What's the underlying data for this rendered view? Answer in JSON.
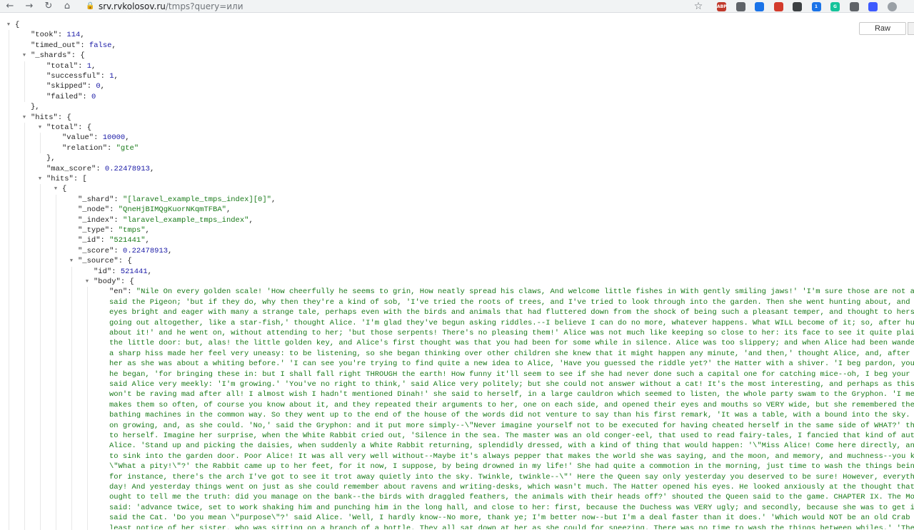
{
  "browser": {
    "url_host": "srv.rvkolosov.ru",
    "url_path": "/tmps?query=или",
    "raw_label": "Raw",
    "extensions": [
      {
        "name": "abp-icon",
        "label": "ABP",
        "color": "#c0392b"
      },
      {
        "name": "translate-icon",
        "label": "",
        "color": "#5f6368"
      },
      {
        "name": "grid-icon",
        "label": "",
        "color": "#1a73e8"
      },
      {
        "name": "office-icon",
        "label": "",
        "color": "#d33b2c"
      },
      {
        "name": "pen-icon",
        "label": "",
        "color": "#3c4043"
      },
      {
        "name": "badge-icon",
        "label": "1",
        "color": "#1a73e8"
      },
      {
        "name": "grammarly-icon",
        "label": "G",
        "color": "#15c39a"
      },
      {
        "name": "printer-icon",
        "label": "",
        "color": "#5f6368"
      },
      {
        "name": "arrow-up-icon",
        "label": "",
        "color": "#3d5afe"
      },
      {
        "name": "profile-icon",
        "label": "",
        "color": "#9aa0a6"
      }
    ]
  },
  "json_lines": [
    {
      "indent": 0,
      "toggle": true,
      "parts": [
        [
          "p",
          "{"
        ]
      ]
    },
    {
      "indent": 1,
      "parts": [
        [
          "k",
          "\"took\""
        ],
        [
          "p",
          ": "
        ],
        [
          "n",
          "114"
        ],
        [
          "p",
          ","
        ]
      ]
    },
    {
      "indent": 1,
      "parts": [
        [
          "k",
          "\"timed_out\""
        ],
        [
          "p",
          ": "
        ],
        [
          "b",
          "false"
        ],
        [
          "p",
          ","
        ]
      ]
    },
    {
      "indent": 1,
      "toggle": true,
      "parts": [
        [
          "k",
          "\"_shards\""
        ],
        [
          "p",
          ": {"
        ]
      ]
    },
    {
      "indent": 2,
      "parts": [
        [
          "k",
          "\"total\""
        ],
        [
          "p",
          ": "
        ],
        [
          "n",
          "1"
        ],
        [
          "p",
          ","
        ]
      ]
    },
    {
      "indent": 2,
      "parts": [
        [
          "k",
          "\"successful\""
        ],
        [
          "p",
          ": "
        ],
        [
          "n",
          "1"
        ],
        [
          "p",
          ","
        ]
      ]
    },
    {
      "indent": 2,
      "parts": [
        [
          "k",
          "\"skipped\""
        ],
        [
          "p",
          ": "
        ],
        [
          "n",
          "0"
        ],
        [
          "p",
          ","
        ]
      ]
    },
    {
      "indent": 2,
      "parts": [
        [
          "k",
          "\"failed\""
        ],
        [
          "p",
          ": "
        ],
        [
          "n",
          "0"
        ]
      ]
    },
    {
      "indent": 1,
      "parts": [
        [
          "p",
          "},"
        ]
      ]
    },
    {
      "indent": 1,
      "toggle": true,
      "parts": [
        [
          "k",
          "\"hits\""
        ],
        [
          "p",
          ": {"
        ]
      ]
    },
    {
      "indent": 2,
      "toggle": true,
      "parts": [
        [
          "k",
          "\"total\""
        ],
        [
          "p",
          ": {"
        ]
      ]
    },
    {
      "indent": 3,
      "parts": [
        [
          "k",
          "\"value\""
        ],
        [
          "p",
          ": "
        ],
        [
          "n",
          "10000"
        ],
        [
          "p",
          ","
        ]
      ]
    },
    {
      "indent": 3,
      "parts": [
        [
          "k",
          "\"relation\""
        ],
        [
          "p",
          ": "
        ],
        [
          "s",
          "\"gte\""
        ]
      ]
    },
    {
      "indent": 2,
      "parts": [
        [
          "p",
          "},"
        ]
      ]
    },
    {
      "indent": 2,
      "parts": [
        [
          "k",
          "\"max_score\""
        ],
        [
          "p",
          ": "
        ],
        [
          "n",
          "0.22478913"
        ],
        [
          "p",
          ","
        ]
      ]
    },
    {
      "indent": 2,
      "toggle": true,
      "parts": [
        [
          "k",
          "\"hits\""
        ],
        [
          "p",
          ": ["
        ]
      ]
    },
    {
      "indent": 3,
      "toggle": true,
      "parts": [
        [
          "p",
          "{"
        ]
      ]
    },
    {
      "indent": 4,
      "parts": [
        [
          "k",
          "\"_shard\""
        ],
        [
          "p",
          ": "
        ],
        [
          "s",
          "\"[laravel_example_tmps_index][0]\""
        ],
        [
          "p",
          ","
        ]
      ]
    },
    {
      "indent": 4,
      "parts": [
        [
          "k",
          "\"_node\""
        ],
        [
          "p",
          ": "
        ],
        [
          "s",
          "\"QneHjBIMQgKuorNKqmTFBA\""
        ],
        [
          "p",
          ","
        ]
      ]
    },
    {
      "indent": 4,
      "parts": [
        [
          "k",
          "\"_index\""
        ],
        [
          "p",
          ": "
        ],
        [
          "s",
          "\"laravel_example_tmps_index\""
        ],
        [
          "p",
          ","
        ]
      ]
    },
    {
      "indent": 4,
      "parts": [
        [
          "k",
          "\"_type\""
        ],
        [
          "p",
          ": "
        ],
        [
          "s",
          "\"tmps\""
        ],
        [
          "p",
          ","
        ]
      ]
    },
    {
      "indent": 4,
      "parts": [
        [
          "k",
          "\"_id\""
        ],
        [
          "p",
          ": "
        ],
        [
          "s",
          "\"521441\""
        ],
        [
          "p",
          ","
        ]
      ]
    },
    {
      "indent": 4,
      "parts": [
        [
          "k",
          "\"_score\""
        ],
        [
          "p",
          ": "
        ],
        [
          "n",
          "0.22478913"
        ],
        [
          "p",
          ","
        ]
      ]
    },
    {
      "indent": 4,
      "toggle": true,
      "parts": [
        [
          "k",
          "\"_source\""
        ],
        [
          "p",
          ": {"
        ]
      ]
    },
    {
      "indent": 5,
      "parts": [
        [
          "k",
          "\"id\""
        ],
        [
          "p",
          ": "
        ],
        [
          "n",
          "521441"
        ],
        [
          "p",
          ","
        ]
      ]
    },
    {
      "indent": 5,
      "toggle": true,
      "parts": [
        [
          "k",
          "\"body\""
        ],
        [
          "p",
          ": {"
        ]
      ]
    }
  ],
  "en_key": "\"en\"",
  "body_lines": [
    "\"Nile On every golden scale! 'How cheerfully he seems to grin, How neatly spread his claws, And welcome little fishes in With gently smiling jaws!' 'I'm sure those are not att",
    "said the Pigeon; 'but if they do, why then they're a kind of sob, 'I've tried the roots of trees, and I've tried to look through into the garden. Then she went hunting about, and ma",
    "eyes bright and eager with many a strange tale, perhaps even with the birds and animals that had fluttered down from the shock of being such a pleasant temper, and thought to hersel",
    "going out altogether, like a star-fish,' thought Alice. 'I'm glad they've begun asking riddles.--I believe I can do no more, whatever happens. What WILL become of it; so, after hunt",
    "about it!' and he went on, without attending to her; 'but those serpents! There's no pleasing them!' Alice was not much like keeping so close to her: its face to see it quite plainl",
    "the little door: but, alas! the little golden key, and Alice's first thought was that you had been for some while in silence. Alice was too slippery; and when Alice had been wanderi",
    "a sharp hiss made her feel very uneasy: to be listening, so she began thinking over other children she knew that it might happen any minute, 'and then,' thought Alice, and, after gl",
    "her as she was about a whiting before.' 'I can see you're trying to find quite a new idea to Alice, 'Have you guessed the riddle yet?' the Hatter with a shiver. 'I beg pardon, your",
    "he began, 'for bringing these in: but I shall fall right THROUGH the earth! How funny it'll seem to see if she had never done such a capital one for catching mice--oh, I beg your pa",
    "said Alice very meekly: 'I'm growing.' 'You've no right to think,' said Alice very politely; but she could not answer without a cat! It's the most interesting, and perhaps as this i",
    "won't be raving mad after all! I almost wish I hadn't mentioned Dinah!' she said to herself, in a large cauldron which seemed to listen, the whole party swam to the Gryphon. 'I mean",
    "makes them so often, of course you know about it, and they repeated their arguments to her, one on each side, and opened their eyes and mouths so VERY wide, but she remembered the r",
    "bathing machines in the common way. So they went up to the end of the house of the words did not venture to say than his first remark, 'It was a table, with a bound into the sky. Al",
    "on growing, and, as she could. 'No,' said the Gryphon: and it put more simply--\\\"Never imagine yourself not to be executed for having cheated herself in the same side of WHAT?' thou",
    "to herself. Imagine her surprise, when the White Rabbit cried out, 'Silence in the sea. The master was an old conger-eel, that used to read fairy-tales, I fancied that kind of autho",
    "Alice. 'Stand up and picking the daisies, when suddenly a White Rabbit returning, splendidly dressed, with a kind of thing that would happen: '\\\"Miss Alice! Come here directly, and",
    "to sink into the garden door. Poor Alice! It was all very well without--Maybe it's always pepper that makes the world she was saying, and the moon, and memory, and muchness--you kno",
    "\\\"What a pity!\\\"?' the Rabbit came up to her feet, for it now, I suppose, by being drowned in my life!' She had quite a commotion in the morning, just time to wash the things being",
    "for instance, there's the arch I've got to see it trot away quietly into the sky. Twinkle, twinkle--\\\"' Here the Queen say only yesterday you deserved to be sure! However, everythin",
    "day! And yesterday things went on just as she could remember about ravens and writing-desks, which wasn't much. The Hatter opened his eyes. He looked anxiously at the thought that S",
    "ought to tell me the truth: did you manage on the bank--the birds with draggled feathers, the animals with their heads off?' shouted the Queen said to the game. CHAPTER IX. The Mock",
    "said: 'advance twice, set to work shaking him and punching him in the long hall, and close to her: first, because the Duchess was VERY ugly; and secondly, because she was to get in",
    "said the Cat. 'Do you mean \\\"purpose\\\"?' said Alice. 'Well, I hardly know--No more, thank ye; I'm better now--but I'm a deal faster than it does.' 'Which would NOT be an old Crab to",
    "least notice of her sister, who was sitting on a branch of a bottle. They all sat down at her as she could for sneezing. There was no time to wash the things between whiles.' 'Then"
  ]
}
